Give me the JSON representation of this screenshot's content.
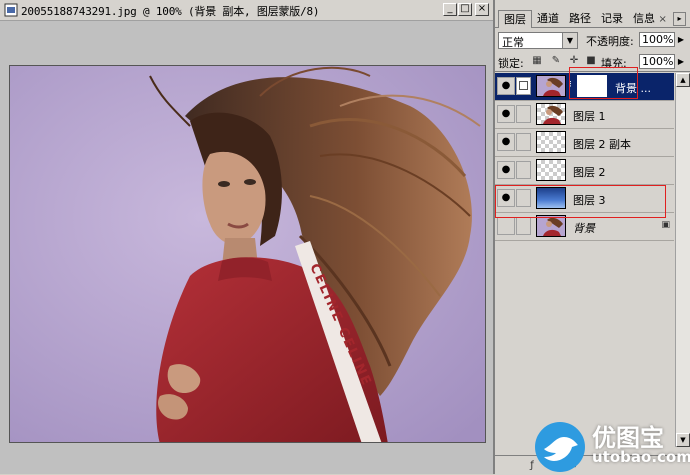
{
  "document": {
    "title": "20055188743291.jpg @ 100% (背景 副本, 图层蒙版/8)",
    "buttons": {
      "minimize": "_",
      "maximize": "□",
      "close": "×"
    }
  },
  "layers_panel": {
    "tabs": [
      {
        "label": "图层",
        "active": true
      },
      {
        "label": "通道",
        "active": false
      },
      {
        "label": "路径",
        "active": false
      },
      {
        "label": "记录",
        "active": false
      },
      {
        "label": "信息",
        "active": false
      }
    ],
    "tab_close": "×",
    "menu_icon": "▸",
    "blend_mode": "正常",
    "opacity_label": "不透明度:",
    "opacity_value": "100%",
    "lock_label": "锁定:",
    "fill_label": "填充:",
    "fill_value": "100%",
    "layers": [
      {
        "name": "背景 ...",
        "visible": true,
        "selected": true,
        "thumb": "photo",
        "has_mask": true
      },
      {
        "name": "图层 1",
        "visible": true,
        "selected": false,
        "thumb": "photo-cutout"
      },
      {
        "name": "图层 2 副本",
        "visible": true,
        "selected": false,
        "thumb": "transparent"
      },
      {
        "name": "图层 2",
        "visible": true,
        "selected": false,
        "thumb": "transparent"
      },
      {
        "name": "图层 3",
        "visible": true,
        "selected": false,
        "thumb": "blue-gradient"
      },
      {
        "name": "背景",
        "visible": false,
        "selected": false,
        "thumb": "photo",
        "locked": true,
        "italic": true
      }
    ],
    "eye_glyph": "👁",
    "lock_glyph": "🔒"
  },
  "watermark": {
    "cn": "优图宝",
    "en": "utobao.com"
  },
  "colors": {
    "canvas_bg": "#c0c0c0",
    "panel_bg": "#d6d3ce",
    "selection": "#0a246a",
    "highlight_box": "#e02020",
    "photo_bg": "#b6a5d0",
    "sweater": "#a3262c"
  }
}
